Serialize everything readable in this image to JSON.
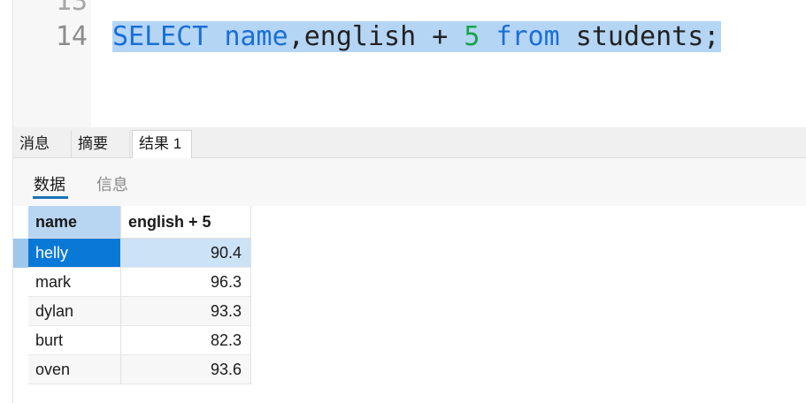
{
  "editor": {
    "prev_line_number": "13",
    "line_number": "14",
    "tokens": {
      "select": "SELECT",
      "name": "name",
      "comma_english_plus": ",english + ",
      "five": "5",
      "from": "from",
      "students": " students;"
    }
  },
  "tabs": [
    {
      "label": "消息"
    },
    {
      "label": "摘要"
    },
    {
      "label": "结果 1"
    }
  ],
  "subtabs": [
    {
      "label": "数据"
    },
    {
      "label": "信息"
    }
  ],
  "grid": {
    "columns": [
      "name",
      "english + 5"
    ],
    "rows": [
      [
        "helly",
        "90.4"
      ],
      [
        "mark",
        "96.3"
      ],
      [
        "dylan",
        "93.3"
      ],
      [
        "burt",
        "82.3"
      ],
      [
        "oven",
        "93.6"
      ]
    ]
  },
  "colors": {
    "keyword": "#1a6fd6",
    "number": "#16a34a",
    "selection": "#b5d5f5",
    "selected_cell": "#0a78d7"
  }
}
